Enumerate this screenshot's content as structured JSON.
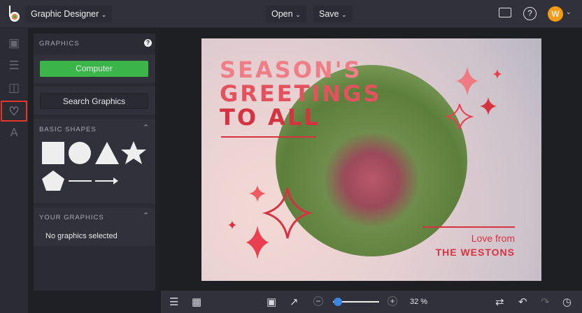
{
  "header": {
    "app_menu": "Graphic Designer",
    "open_label": "Open",
    "save_label": "Save",
    "avatar_initial": "W"
  },
  "panel": {
    "title": "GRAPHICS",
    "computer_label": "Computer",
    "search_label": "Search Graphics",
    "basic_shapes_label": "BASIC SHAPES",
    "your_graphics_label": "YOUR GRAPHICS",
    "no_graphics_text": "No graphics selected"
  },
  "card": {
    "line1": "SEASON'S",
    "line2": "GREETINGS",
    "line3": "TO ALL",
    "love_from": "Love from",
    "family": "THE WESTONS"
  },
  "toolbar": {
    "zoom_percent": "32 %",
    "zoom_value": 0.1
  },
  "colors": {
    "accent_green": "#3bb54a",
    "brand_orange": "#f39c12",
    "card_red": "#d63341",
    "selection": "#e0352b"
  }
}
